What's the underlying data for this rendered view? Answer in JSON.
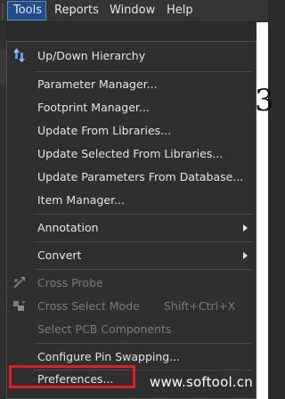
{
  "menubar": {
    "items": [
      {
        "label": "Tools"
      },
      {
        "label": "Reports"
      },
      {
        "label": "Window"
      },
      {
        "label": "Help"
      }
    ]
  },
  "background_fragment": "3",
  "tools_menu": {
    "up_down_hierarchy": "Up/Down Hierarchy",
    "parameter_manager": "Parameter Manager...",
    "footprint_manager": "Footprint Manager...",
    "update_from_libraries": "Update From Libraries...",
    "update_selected_from_libraries": "Update Selected From Libraries...",
    "update_parameters_from_database": "Update Parameters From Database...",
    "item_manager": "Item Manager...",
    "annotation": "Annotation",
    "convert": "Convert",
    "cross_probe": "Cross Probe",
    "cross_select_mode": "Cross Select Mode",
    "cross_select_mode_shortcut": "Shift+Ctrl+X",
    "select_pcb_components": "Select PCB Components",
    "configure_pin_swapping": "Configure Pin Swapping...",
    "preferences": "Preferences..."
  },
  "watermark": "www.softool.cn",
  "colors": {
    "menu_active_bg": "#1f4e8a",
    "highlight_border": "#e31b23",
    "icon_blue": "#5b9bea"
  }
}
